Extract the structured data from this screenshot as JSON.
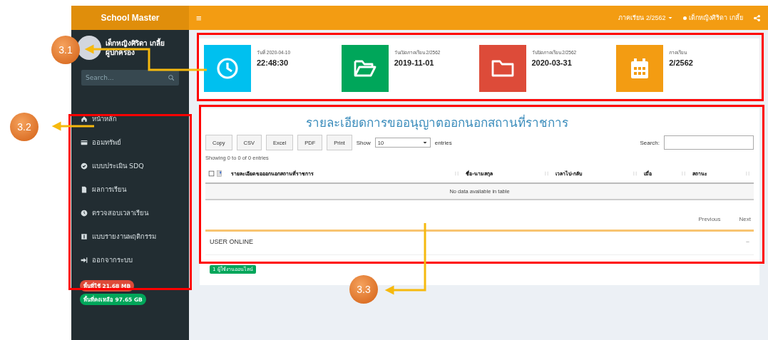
{
  "sidebar": {
    "brand": "School Master",
    "user": {
      "name": "เด็กหญิงศิริดา เกลี้ย",
      "role": "ผู้ปกครอง"
    },
    "search": {
      "placeholder": "Search..."
    },
    "menu": [
      {
        "label": "หน้าหลัก"
      },
      {
        "label": "ออมทรัพย์"
      },
      {
        "label": "แบบประเมิน SDQ"
      },
      {
        "label": "ผลการเรียน"
      },
      {
        "label": "ตรวจสอบเวลาเรียน"
      },
      {
        "label": "แบบรายงานพฤติกรรม"
      },
      {
        "label": "ออกจากระบบ"
      }
    ],
    "badges": [
      {
        "text": "พื้นที่ใช้ 21.68 MB",
        "color": "#dd4b39"
      },
      {
        "text": "พื้นที่คงเหลือ 97.65 GB",
        "color": "#00a65a"
      }
    ]
  },
  "header": {
    "menu_glyph": "≡",
    "term": "ภาคเรียน 2/2562",
    "user": "เด็กหญิงศิริดา เกลี้ย"
  },
  "info_cards": [
    {
      "color": "#00c0ef",
      "label": "วันที่ 2020-04-10",
      "value": "22:48:30"
    },
    {
      "color": "#00a65a",
      "label": "วันเปิดภาคเรียน 2/2562",
      "value": "2019-11-01"
    },
    {
      "color": "#dd4b39",
      "label": "วันปิดภาคเรียน 2/2562",
      "value": "2020-03-31"
    },
    {
      "color": "#f39c12",
      "label": "ภาคเรียน",
      "value": "2/2562"
    }
  ],
  "panel": {
    "title": "รายละเอียดการขออนุญาตออกนอกสถานที่ราชการ",
    "buttons": [
      "Copy",
      "CSV",
      "Excel",
      "PDF",
      "Print"
    ],
    "show_label": "Show",
    "page_size": "10",
    "entries_label": "entries",
    "search_label": "Search:",
    "info": "Showing 0 to 0 of 0 entries",
    "table": {
      "columns": [
        "รายละเอียดขอออกนอกสถานที่ราชการ",
        "ชื่อ-นามสกุล",
        "เวลาไป-กลับ",
        "เมื่อ",
        "สถานะ"
      ],
      "empty": "No data available in table"
    },
    "pager": [
      "Previous",
      "Next"
    ],
    "online": {
      "title": "USER ONLINE",
      "collapse": "−",
      "count": "1 ผู้ใช้งานออนไลน์"
    }
  },
  "annotations": [
    {
      "label": "3.1"
    },
    {
      "label": "3.2"
    },
    {
      "label": "3.3"
    }
  ]
}
